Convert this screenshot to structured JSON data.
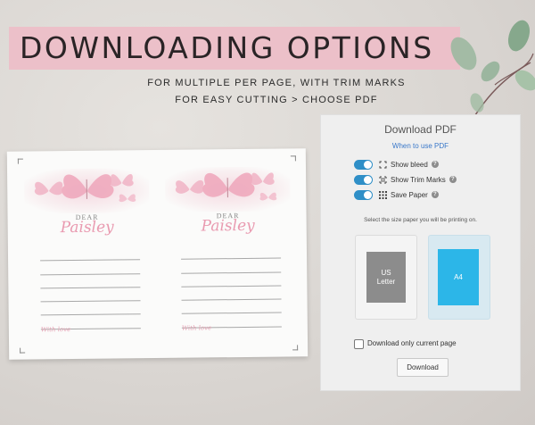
{
  "banner": {
    "title": "DOWNLOADING OPTIONS"
  },
  "subtitle": {
    "line1": "FOR MULTIPLE PER PAGE, WITH TRIM MARKS",
    "line2": "FOR EASY CUTTING > CHOOSE PDF"
  },
  "preview": {
    "cards": [
      {
        "dear": "DEAR",
        "name": "Paisley",
        "signature": "With love"
      },
      {
        "dear": "DEAR",
        "name": "Paisley",
        "signature": "With love"
      }
    ]
  },
  "panel": {
    "title": "Download PDF",
    "help_link": "When to use PDF",
    "options": [
      {
        "label": "Show bleed",
        "icon": "bleed-icon",
        "enabled": true
      },
      {
        "label": "Show Trim Marks",
        "icon": "trim-marks-icon",
        "enabled": true
      },
      {
        "label": "Save Paper",
        "icon": "grid-icon",
        "enabled": true
      }
    ],
    "paper_hint": "Select the size paper you will be printing on.",
    "paper_sizes": [
      {
        "line1": "US",
        "line2": "Letter",
        "selected": false
      },
      {
        "label": "A4",
        "selected": true
      }
    ],
    "current_page_label": "Download only current page",
    "current_page_checked": false,
    "download_label": "Download"
  },
  "colors": {
    "banner": "#ecc0c9",
    "toggle_on": "#2f8fc7",
    "link": "#3a78c9",
    "a4_selected": "#2cb6e8",
    "script_pink": "#e99ab0"
  }
}
